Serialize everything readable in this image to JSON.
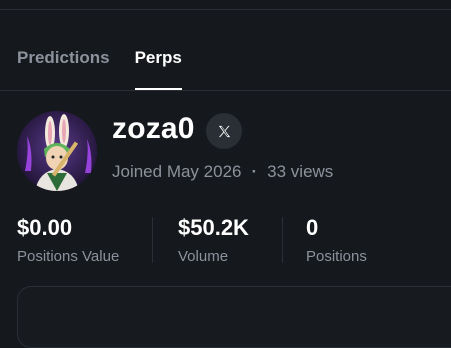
{
  "tabs": [
    {
      "label": "Predictions",
      "active": false
    },
    {
      "label": "Perps",
      "active": true
    }
  ],
  "profile": {
    "username": "zoza0",
    "social_icon": "x-logo-icon",
    "joined": "Joined May 2026",
    "separator": "·",
    "views": "33 views"
  },
  "stats": [
    {
      "value": "$0.00",
      "label": "Positions Value"
    },
    {
      "value": "$50.2K",
      "label": "Volume"
    },
    {
      "value": "0",
      "label": "Positions"
    }
  ],
  "colors": {
    "background": "#15181d",
    "text_primary": "#ffffff",
    "text_muted": "#8b929c",
    "divider": "#2a2f36"
  }
}
